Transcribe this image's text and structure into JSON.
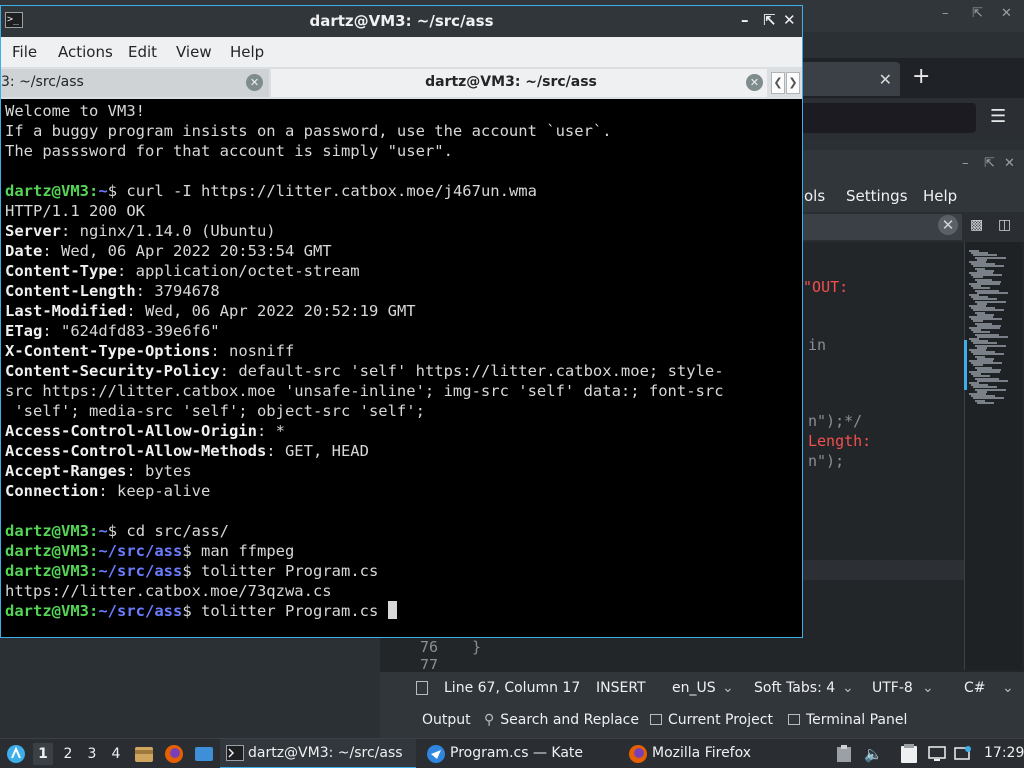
{
  "konsole": {
    "title": "dartz@VM3: ~/src/ass",
    "app_icon": ">_",
    "menu": [
      "File",
      "Actions",
      "Edit",
      "View",
      "Help"
    ],
    "tabs": [
      {
        "label": "3: ~/src/ass"
      },
      {
        "label": "dartz@VM3: ~/src/ass"
      }
    ],
    "terminal": {
      "motd": [
        "Welcome to VM3!",
        "If a buggy program insists on a password, use the account `user`.",
        "The passsword for that account is simply \"user\"."
      ],
      "prompt_user": "dartz@VM3",
      "cmd1": {
        "path": "~",
        "command": "curl -I https://litter.catbox.moe/j467un.wma"
      },
      "status_line": "HTTP/1.1 200 OK",
      "headers": [
        {
          "key": "Server",
          "value": "nginx/1.14.0 (Ubuntu)"
        },
        {
          "key": "Date",
          "value": "Wed, 06 Apr 2022 20:53:54 GMT"
        },
        {
          "key": "Content-Type",
          "value": "application/octet-stream"
        },
        {
          "key": "Content-Length",
          "value": "3794678"
        },
        {
          "key": "Last-Modified",
          "value": "Wed, 06 Apr 2022 20:52:19 GMT"
        },
        {
          "key": "ETag",
          "value": "\"624dfd83-39e6f6\""
        },
        {
          "key": "X-Content-Type-Options",
          "value": "nosniff"
        },
        {
          "key": "Content-Security-Policy",
          "value": "default-src 'self' https://litter.catbox.moe; style-"
        },
        {
          "key": "",
          "value": "src https://litter.catbox.moe 'unsafe-inline'; img-src 'self' data:; font-src"
        },
        {
          "key": "",
          "value": " 'self'; media-src 'self'; object-src 'self';"
        },
        {
          "key": "Access-Control-Allow-Origin",
          "value": "*"
        },
        {
          "key": "Access-Control-Allow-Methods",
          "value": "GET, HEAD"
        },
        {
          "key": "Accept-Ranges",
          "value": "bytes"
        },
        {
          "key": "Connection",
          "value": "keep-alive"
        }
      ],
      "cmd2": {
        "path": "~",
        "command": "cd src/ass/"
      },
      "cmd3": {
        "path": "~/src/ass",
        "command": "man ffmpeg"
      },
      "cmd4": {
        "path": "~/src/ass",
        "command": "tolitter Program.cs"
      },
      "output4": "https://litter.catbox.moe/73qzwa.cs",
      "cmd5": {
        "path": "~/src/ass",
        "command": "tolitter Program.cs "
      }
    }
  },
  "kate": {
    "menu_partial": [
      "ols",
      "Settings",
      "Help"
    ],
    "code_fragments": [
      "s\"OUT:",
      "in",
      "n\");*/",
      "Length:",
      "n\");"
    ],
    "gutter": [
      "76",
      "77"
    ],
    "gutter_code": "}",
    "status": {
      "position": "Line 67, Column 17",
      "mode": "INSERT",
      "language": "en_US",
      "indent": "Soft Tabs: 4",
      "encoding": "UTF-8",
      "syntax": "C#"
    },
    "toolviews": [
      "Output",
      "Search and Replace",
      "Current Project",
      "Terminal Panel"
    ]
  },
  "taskbar": {
    "desktops": [
      "1",
      "2",
      "3",
      "4"
    ],
    "tasks": [
      {
        "label": "dartz@VM3: ~/src/ass"
      },
      {
        "label": "Program.cs — Kate"
      },
      {
        "label": "Mozilla Firefox"
      }
    ],
    "clock": "17:29"
  },
  "colors": {
    "accent": "#3daee9",
    "prompt_user": "#55d455",
    "prompt_path": "#6b7cff",
    "code_string": "#f44f4f"
  }
}
